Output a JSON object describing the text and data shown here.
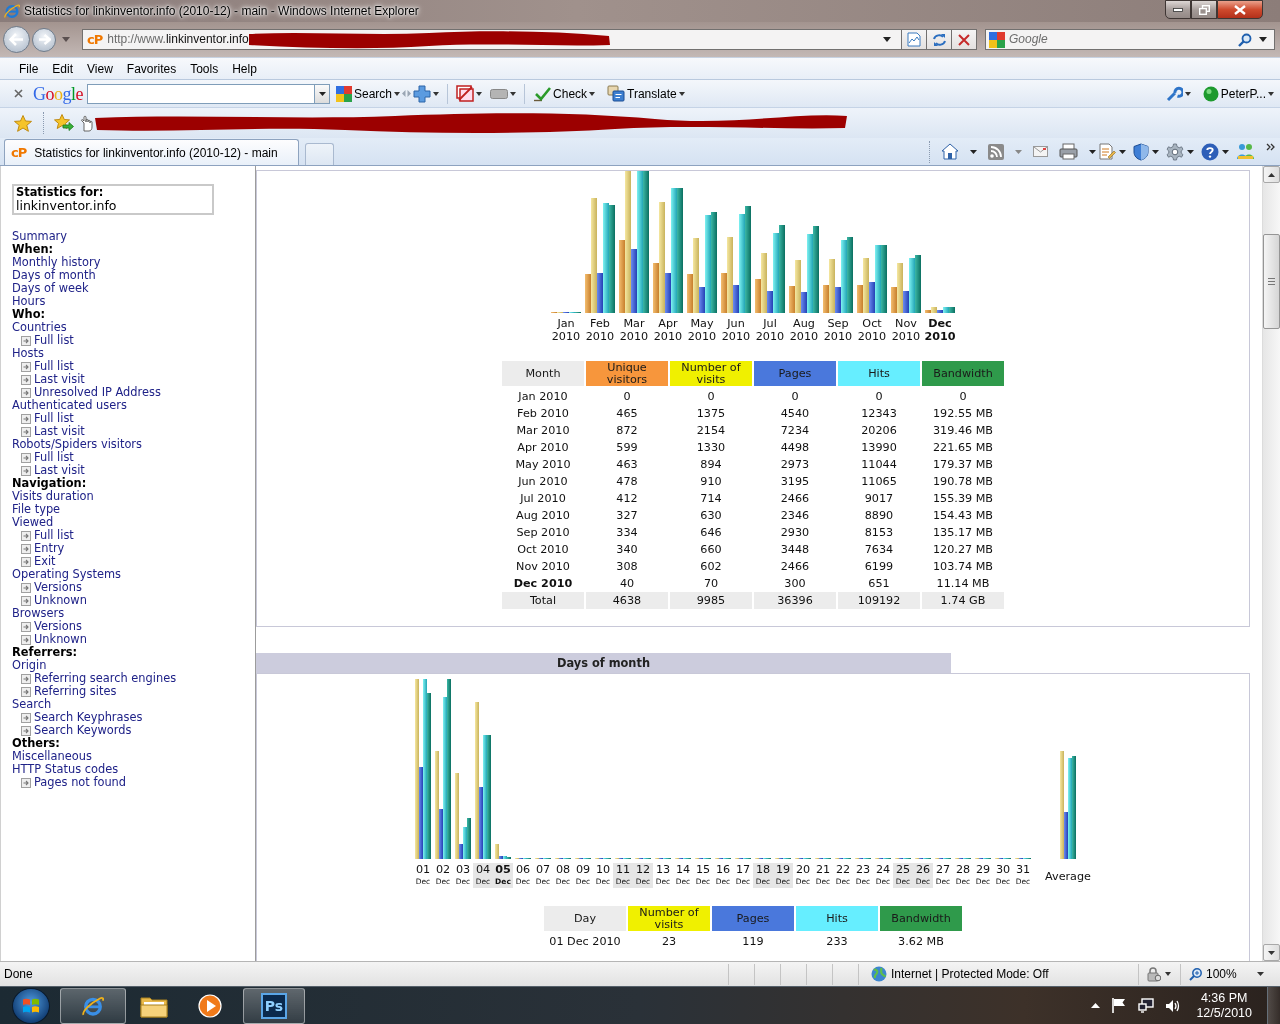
{
  "window": {
    "title": "Statistics for linkinventor.info (2010-12) - main - Windows Internet Explorer"
  },
  "address_bar": {
    "favicon": "cP",
    "url_prefix": "http://www.",
    "url_domain": "linkinventor.info"
  },
  "search_box": {
    "placeholder": "Google"
  },
  "menu_bar": [
    "File",
    "Edit",
    "View",
    "Favorites",
    "Tools",
    "Help"
  ],
  "google_toolbar": {
    "logo": "Google",
    "buttons": [
      "Search",
      "Check",
      "Translate"
    ],
    "account": "PeterP..."
  },
  "tabs": [
    {
      "favicon": "cP",
      "label": "Statistics for linkinventor.info (2010-12) - main",
      "selected": true
    }
  ],
  "sidebar": {
    "title": "Statistics for:",
    "site": "linkinventor.info",
    "items": [
      {
        "kind": "link",
        "label": "Summary"
      },
      {
        "kind": "heading",
        "label": "When:"
      },
      {
        "kind": "link",
        "label": "Monthly history"
      },
      {
        "kind": "link",
        "label": "Days of month"
      },
      {
        "kind": "link",
        "label": "Days of week"
      },
      {
        "kind": "link",
        "label": "Hours"
      },
      {
        "kind": "heading",
        "label": "Who:"
      },
      {
        "kind": "link",
        "label": "Countries",
        "children": [
          {
            "label": "Full list"
          }
        ]
      },
      {
        "kind": "link",
        "label": "Hosts",
        "children": [
          {
            "label": "Full list"
          },
          {
            "label": "Last visit"
          },
          {
            "label": "Unresolved IP Address"
          }
        ]
      },
      {
        "kind": "link",
        "label": "Authenticated users",
        "children": [
          {
            "label": "Full list"
          },
          {
            "label": "Last visit"
          }
        ]
      },
      {
        "kind": "link",
        "label": "Robots/Spiders visitors",
        "children": [
          {
            "label": "Full list"
          },
          {
            "label": "Last visit"
          }
        ]
      },
      {
        "kind": "heading",
        "label": "Navigation:"
      },
      {
        "kind": "link",
        "label": "Visits duration"
      },
      {
        "kind": "link",
        "label": "File type"
      },
      {
        "kind": "link",
        "label": "Viewed",
        "children": [
          {
            "label": "Full list"
          },
          {
            "label": "Entry"
          },
          {
            "label": "Exit"
          }
        ]
      },
      {
        "kind": "link",
        "label": "Operating Systems",
        "children": [
          {
            "label": "Versions"
          },
          {
            "label": "Unknown"
          }
        ]
      },
      {
        "kind": "link",
        "label": "Browsers",
        "children": [
          {
            "label": "Versions"
          },
          {
            "label": "Unknown"
          }
        ]
      },
      {
        "kind": "heading",
        "label": "Referrers:"
      },
      {
        "kind": "link",
        "label": "Origin",
        "children": [
          {
            "label": "Referring search engines"
          },
          {
            "label": "Referring sites"
          }
        ]
      },
      {
        "kind": "link",
        "label": "Search",
        "children": [
          {
            "label": "Search Keyphrases"
          },
          {
            "label": "Search Keywords"
          }
        ]
      },
      {
        "kind": "heading",
        "label": "Others:"
      },
      {
        "kind": "link",
        "label": "Miscellaneous"
      },
      {
        "kind": "link",
        "label": "HTTP Status codes",
        "children": [
          {
            "label": "Pages not found"
          }
        ]
      }
    ]
  },
  "monthly_chart": {
    "months": [
      {
        "label": "Jan 2010",
        "current": false
      },
      {
        "label": "Feb 2010",
        "current": false
      },
      {
        "label": "Mar 2010",
        "current": false
      },
      {
        "label": "Apr 2010",
        "current": false
      },
      {
        "label": "May 2010",
        "current": false
      },
      {
        "label": "Jun 2010",
        "current": false
      },
      {
        "label": "Jul 2010",
        "current": false
      },
      {
        "label": "Aug 2010",
        "current": false
      },
      {
        "label": "Sep 2010",
        "current": false
      },
      {
        "label": "Oct 2010",
        "current": false
      },
      {
        "label": "Nov 2010",
        "current": false
      },
      {
        "label": "Dec 2010",
        "current": true
      }
    ]
  },
  "monthly_table": {
    "columns": [
      {
        "label": "Month",
        "color": "#ececec"
      },
      {
        "label": "Unique visitors",
        "color": "#f7963c"
      },
      {
        "label": "Number of visits",
        "color": "#f0f000"
      },
      {
        "label": "Pages",
        "color": "#4a78dc"
      },
      {
        "label": "Hits",
        "color": "#66eeff"
      },
      {
        "label": "Bandwidth",
        "color": "#2f9a4b"
      }
    ],
    "rows": [
      {
        "month": "Jan 2010",
        "current": false,
        "values": [
          "0",
          "0",
          "0",
          "0",
          "0"
        ]
      },
      {
        "month": "Feb 2010",
        "current": false,
        "values": [
          "465",
          "1375",
          "4540",
          "12343",
          "192.55 MB"
        ]
      },
      {
        "month": "Mar 2010",
        "current": false,
        "values": [
          "872",
          "2154",
          "7234",
          "20206",
          "319.46 MB"
        ]
      },
      {
        "month": "Apr 2010",
        "current": false,
        "values": [
          "599",
          "1330",
          "4498",
          "13990",
          "221.65 MB"
        ]
      },
      {
        "month": "May 2010",
        "current": false,
        "values": [
          "463",
          "894",
          "2973",
          "11044",
          "179.37 MB"
        ]
      },
      {
        "month": "Jun 2010",
        "current": false,
        "values": [
          "478",
          "910",
          "3195",
          "11065",
          "190.78 MB"
        ]
      },
      {
        "month": "Jul 2010",
        "current": false,
        "values": [
          "412",
          "714",
          "2466",
          "9017",
          "155.39 MB"
        ]
      },
      {
        "month": "Aug 2010",
        "current": false,
        "values": [
          "327",
          "630",
          "2346",
          "8890",
          "154.43 MB"
        ]
      },
      {
        "month": "Sep 2010",
        "current": false,
        "values": [
          "334",
          "646",
          "2930",
          "8153",
          "135.17 MB"
        ]
      },
      {
        "month": "Oct 2010",
        "current": false,
        "values": [
          "340",
          "660",
          "3448",
          "7634",
          "120.27 MB"
        ]
      },
      {
        "month": "Nov 2010",
        "current": false,
        "values": [
          "308",
          "602",
          "2466",
          "6199",
          "103.74 MB"
        ]
      },
      {
        "month": "Dec 2010",
        "current": true,
        "values": [
          "40",
          "70",
          "300",
          "651",
          "11.14 MB"
        ]
      }
    ],
    "total": {
      "label": "Total",
      "values": [
        "4638",
        "9985",
        "36396",
        "109192",
        "1.74 GB"
      ]
    }
  },
  "days_section": {
    "title": "Days of month"
  },
  "days_chart": {
    "days": [
      {
        "day": "01",
        "month": "Dec",
        "weekend": false,
        "today": false
      },
      {
        "day": "02",
        "month": "Dec",
        "weekend": false,
        "today": false
      },
      {
        "day": "03",
        "month": "Dec",
        "weekend": false,
        "today": false
      },
      {
        "day": "04",
        "month": "Dec",
        "weekend": true,
        "today": false
      },
      {
        "day": "05",
        "month": "Dec",
        "weekend": true,
        "today": true
      },
      {
        "day": "06",
        "month": "Dec",
        "weekend": false,
        "today": false
      },
      {
        "day": "07",
        "month": "Dec",
        "weekend": false,
        "today": false
      },
      {
        "day": "08",
        "month": "Dec",
        "weekend": false,
        "today": false
      },
      {
        "day": "09",
        "month": "Dec",
        "weekend": false,
        "today": false
      },
      {
        "day": "10",
        "month": "Dec",
        "weekend": false,
        "today": false
      },
      {
        "day": "11",
        "month": "Dec",
        "weekend": true,
        "today": false
      },
      {
        "day": "12",
        "month": "Dec",
        "weekend": true,
        "today": false
      },
      {
        "day": "13",
        "month": "Dec",
        "weekend": false,
        "today": false
      },
      {
        "day": "14",
        "month": "Dec",
        "weekend": false,
        "today": false
      },
      {
        "day": "15",
        "month": "Dec",
        "weekend": false,
        "today": false
      },
      {
        "day": "16",
        "month": "Dec",
        "weekend": false,
        "today": false
      },
      {
        "day": "17",
        "month": "Dec",
        "weekend": false,
        "today": false
      },
      {
        "day": "18",
        "month": "Dec",
        "weekend": true,
        "today": false
      },
      {
        "day": "19",
        "month": "Dec",
        "weekend": true,
        "today": false
      },
      {
        "day": "20",
        "month": "Dec",
        "weekend": false,
        "today": false
      },
      {
        "day": "21",
        "month": "Dec",
        "weekend": false,
        "today": false
      },
      {
        "day": "22",
        "month": "Dec",
        "weekend": false,
        "today": false
      },
      {
        "day": "23",
        "month": "Dec",
        "weekend": false,
        "today": false
      },
      {
        "day": "24",
        "month": "Dec",
        "weekend": false,
        "today": false
      },
      {
        "day": "25",
        "month": "Dec",
        "weekend": true,
        "today": false
      },
      {
        "day": "26",
        "month": "Dec",
        "weekend": true,
        "today": false
      },
      {
        "day": "27",
        "month": "Dec",
        "weekend": false,
        "today": false
      },
      {
        "day": "28",
        "month": "Dec",
        "weekend": false,
        "today": false
      },
      {
        "day": "29",
        "month": "Dec",
        "weekend": false,
        "today": false
      },
      {
        "day": "30",
        "month": "Dec",
        "weekend": false,
        "today": false
      },
      {
        "day": "31",
        "month": "Dec",
        "weekend": false,
        "today": false
      }
    ],
    "average_label": "Average"
  },
  "days_table": {
    "columns": [
      {
        "label": "Day",
        "color": "#ececec"
      },
      {
        "label": "Number of visits",
        "color": "#f0f000"
      },
      {
        "label": "Pages",
        "color": "#4a78dc"
      },
      {
        "label": "Hits",
        "color": "#66eeff"
      },
      {
        "label": "Bandwidth",
        "color": "#2f9a4b"
      }
    ],
    "rows": [
      {
        "day": "01 Dec 2010",
        "values": [
          "23",
          "119",
          "233",
          "3.62 MB"
        ]
      }
    ]
  },
  "status_bar": {
    "text": "Done",
    "zone": "Internet | Protected Mode: Off",
    "zoom": "100%"
  },
  "taskbar": {
    "apps": [
      {
        "kind": "browser",
        "running": true
      },
      {
        "kind": "folder",
        "running": false
      },
      {
        "kind": "media",
        "running": false
      },
      {
        "kind": "photoshop",
        "label": "Ps",
        "running": true
      }
    ],
    "time": "4:36 PM",
    "date": "12/5/2010"
  }
}
